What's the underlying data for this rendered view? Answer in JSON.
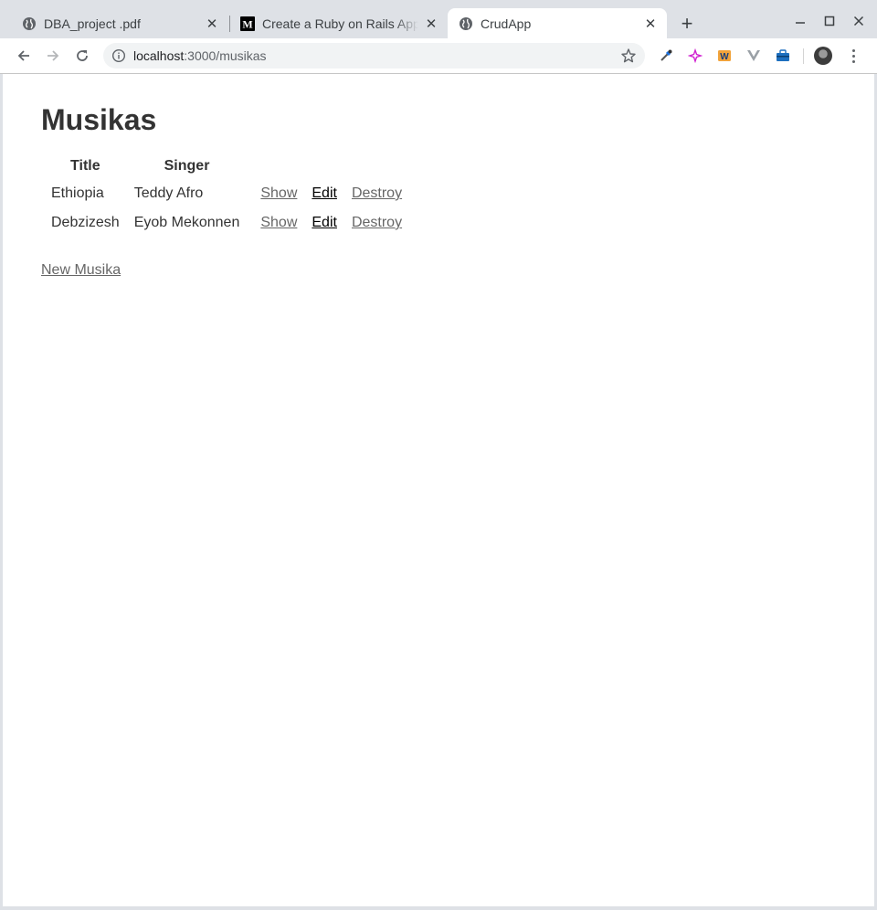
{
  "browser": {
    "tabs": [
      {
        "title": "DBA_project .pdf",
        "icon": "globe-icon",
        "active": false
      },
      {
        "title": "Create a Ruby on Rails App",
        "icon": "medium-logo-icon",
        "active": false
      },
      {
        "title": "CrudApp",
        "icon": "globe-icon",
        "active": true
      }
    ],
    "new_tab_label": "+",
    "url_host": "localhost",
    "url_path": ":3000/musikas"
  },
  "page": {
    "heading": "Musikas",
    "columns": {
      "title": "Title",
      "singer": "Singer"
    },
    "rows": [
      {
        "title": "Ethiopia",
        "singer": "Teddy Afro",
        "show": "Show",
        "edit": "Edit",
        "destroy": "Destroy"
      },
      {
        "title": "Debzizesh",
        "singer": "Eyob Mekonnen",
        "show": "Show",
        "edit": "Edit",
        "destroy": "Destroy"
      }
    ],
    "new_link": "New Musika"
  },
  "colors": {
    "text": "#333333",
    "link": "#666666",
    "link_visited": "#000000",
    "tabstrip": "#dee1e6"
  }
}
